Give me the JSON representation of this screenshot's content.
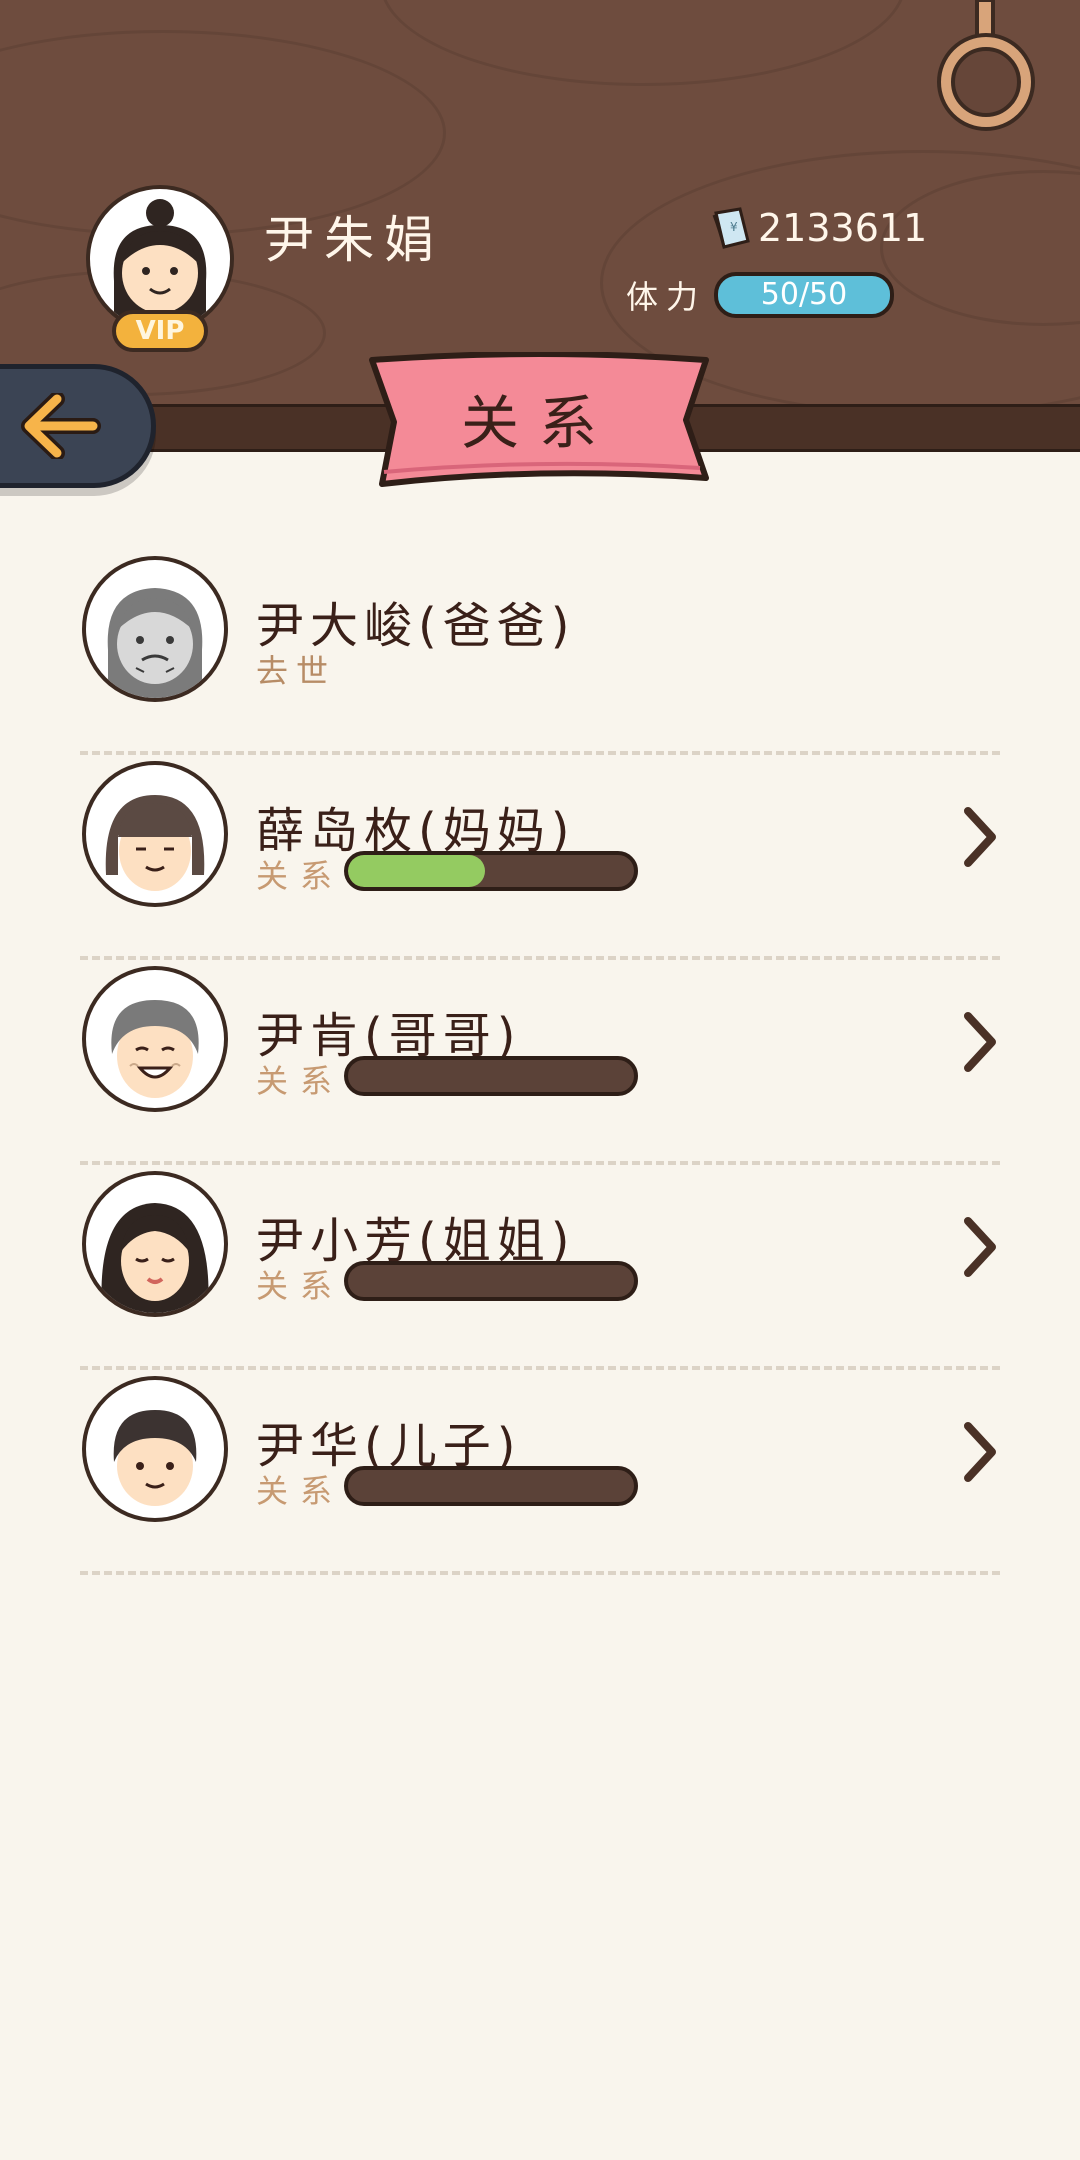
{
  "player": {
    "name": "尹朱娟",
    "vip_label": "VIP",
    "money": "2133611",
    "stamina_label": "体力",
    "stamina": "50/50"
  },
  "title": "关系",
  "relation_label": "关系",
  "relatives": [
    {
      "name": "尹大峻(爸爸)",
      "status": "去世",
      "relationship": null
    },
    {
      "name": "薛岛枚(妈妈)",
      "status": null,
      "relationship": 0.48
    },
    {
      "name": "尹肯(哥哥)",
      "status": null,
      "relationship": 0
    },
    {
      "name": "尹小芳(姐姐)",
      "status": null,
      "relationship": 0
    },
    {
      "name": "尹华(儿子)",
      "status": null,
      "relationship": 0
    }
  ],
  "colors": {
    "wood": "#6e4c3e",
    "banner": "#f48a97",
    "stamina": "#5ebfd9",
    "relationship_fill": "#94cb61",
    "vip": "#f3b23d"
  },
  "icons": [
    "hook-icon",
    "money-icon",
    "back-arrow-icon",
    "chevron-right-icon"
  ]
}
